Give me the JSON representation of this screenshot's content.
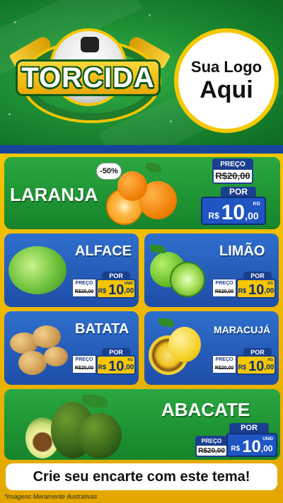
{
  "header": {
    "title": "TORCIDA",
    "logo_line1": "Sua Logo",
    "logo_line2": "Aqui"
  },
  "products": [
    {
      "name": "LARANJA",
      "badge": "-50%",
      "old_label": "PREÇO",
      "old_price": "R$20,00",
      "por_label": "POR",
      "currency": "R$",
      "price_int": "10",
      "price_dec": ",00",
      "unit": "KG"
    },
    {
      "name": "ALFACE",
      "por_label": "POR",
      "old_label": "PREÇO",
      "old_price": "R$20,00",
      "currency": "R$",
      "price_int": "10",
      "price_dec": ",00",
      "unit": "UNID"
    },
    {
      "name": "LIMÃO",
      "por_label": "POR",
      "old_label": "PREÇO",
      "old_price": "R$20,00",
      "currency": "R$",
      "price_int": "10",
      "price_dec": ",00",
      "unit": "KG"
    },
    {
      "name": "BATATA",
      "por_label": "POR",
      "old_label": "PREÇO",
      "old_price": "R$20,00",
      "currency": "R$",
      "price_int": "10",
      "price_dec": ",00",
      "unit": "KG"
    },
    {
      "name": "MARACUJÁ",
      "por_label": "POR",
      "old_label": "PREÇO",
      "old_price": "R$20,00",
      "currency": "R$",
      "price_int": "10",
      "price_dec": ",00",
      "unit": "KG"
    },
    {
      "name": "ABACATE",
      "por_label": "POR",
      "old_label": "PREÇO",
      "old_price": "R$20,00",
      "currency": "R$",
      "price_int": "10",
      "price_dec": ",00",
      "unit": "UNID"
    }
  ],
  "cta": "Crie seu encarte com este tema!",
  "disclaimer": "*Imagens Meramente Ilustrativas",
  "colors": {
    "green": "#1e8f34",
    "blue": "#1d4ea8",
    "yellow": "#f5c400",
    "navy": "#1b3f8f"
  }
}
